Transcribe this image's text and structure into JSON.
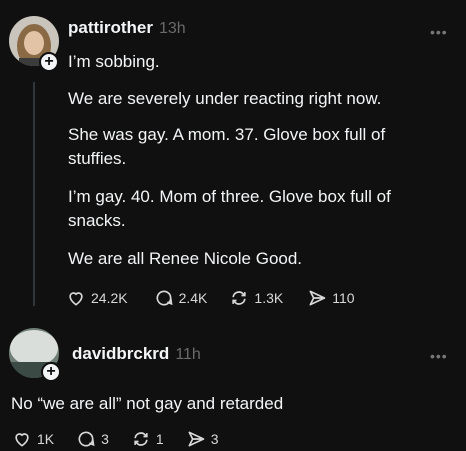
{
  "post1": {
    "username": "pattirother",
    "time": "13h",
    "paragraphs": [
      "I’m sobbing.",
      "We are severely under reacting right now.",
      "She was gay. A mom. 37. Glove box full of\nstuffies.",
      "I’m gay. 40. Mom of three. Glove box full of\nsnacks.",
      "We are all Renee Nicole Good."
    ],
    "likes": "24.2K",
    "replies": "2.4K",
    "reposts": "1.3K",
    "shares": "110",
    "icons": {
      "follow": "plus-icon",
      "more": "more-icon",
      "like": "heart-icon",
      "reply": "comment-icon",
      "repost": "repost-icon",
      "share": "send-icon"
    }
  },
  "post2": {
    "username": "davidbrckrd",
    "time": "11h",
    "text": "No “we are all” not gay and retarded",
    "likes": "1K",
    "replies": "3",
    "reposts": "1",
    "shares": "3"
  },
  "more_glyph": "•••",
  "plus_glyph": "+",
  "colors": {
    "background": "#101010",
    "text": "#f3f5f7",
    "muted": "#6a6a6a",
    "thread_line": "#333638"
  }
}
